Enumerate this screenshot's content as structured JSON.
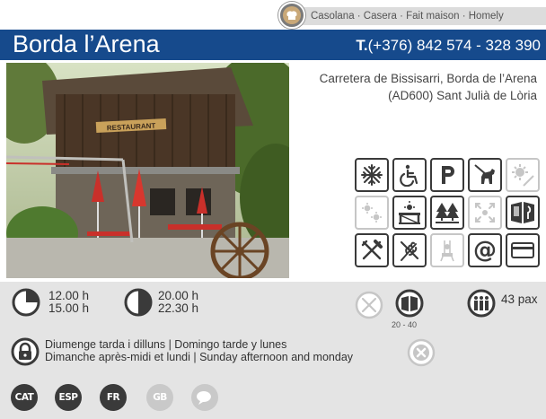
{
  "header": {
    "cuisine": "Casolana · Casera · Fait maison · Homely",
    "restaurant_name": "Borda l’Arena",
    "phone_prefix": "T.",
    "phone": "(+376) 842 574 - 328 390"
  },
  "photo": {
    "sign_text": "RESTAURANT"
  },
  "address": {
    "line1": "Carretera de Bissisarri, Borda de l’Arena",
    "line2": "(AD600) Sant Julià de Lòria"
  },
  "amenities": [
    {
      "icon": "air-conditioning-icon",
      "active": true
    },
    {
      "icon": "wheelchair-icon",
      "active": true
    },
    {
      "icon": "parking-icon",
      "active": true
    },
    {
      "icon": "pets-allowed-icon",
      "active": true
    },
    {
      "icon": "terrace-sun-icon",
      "active": false
    },
    {
      "icon": "heating-icon",
      "active": false
    },
    {
      "icon": "terrace-view-icon",
      "active": true
    },
    {
      "icon": "mountain-views-icon",
      "active": true
    },
    {
      "icon": "smoking-area-icon",
      "active": false
    },
    {
      "icon": "menu-book-icon",
      "active": true
    },
    {
      "icon": "cutlery-icon",
      "active": true
    },
    {
      "icon": "gluten-free-icon",
      "active": true
    },
    {
      "icon": "kids-chair-icon",
      "active": false
    },
    {
      "icon": "email-icon",
      "active": true
    },
    {
      "icon": "credit-card-icon",
      "active": true
    }
  ],
  "schedule": {
    "lunch_open": "12.00 h",
    "lunch_close": "15.00 h",
    "dinner_open": "20.00 h",
    "dinner_close": "22.30 h"
  },
  "menu": {
    "price_range": "20 - 40"
  },
  "capacity": "43 pax",
  "closing": {
    "line1": "Diumenge tarda i dilluns | Domingo tarde y lunes",
    "line2": "Dimanche après-midi et lundi | Sunday afternoon and monday"
  },
  "languages": [
    {
      "code": "CAT",
      "active": true
    },
    {
      "code": "ESP",
      "active": true
    },
    {
      "code": "FR",
      "active": true
    },
    {
      "code": "GB",
      "active": false
    }
  ],
  "colors": {
    "brand_blue": "#164a8c",
    "panel_gray": "#e4e4e4",
    "icon_dark": "#3a3a3a",
    "icon_inactive": "#c6c6c6"
  }
}
